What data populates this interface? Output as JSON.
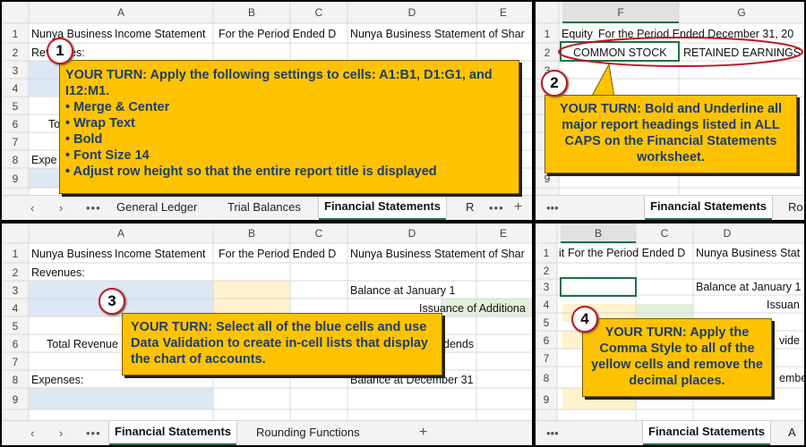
{
  "colors": {
    "accent": "#1e7145",
    "callout": "#fdc300",
    "callout_text": "#1f3d6e",
    "blue_cell": "#dce9f5",
    "yellow_cell": "#fff2cc",
    "green_cell": "#e2efda",
    "badge_ring": "#c0151c"
  },
  "panel1": {
    "columns": [
      "A",
      "B",
      "C",
      "D",
      "E"
    ],
    "rows": [
      "1",
      "2",
      "3",
      "4",
      "5",
      "6",
      "7",
      "8",
      "9"
    ],
    "cells": {
      "a1": "Nunya Business",
      "b1": "Income Statement",
      "c1": "For the Period Ended D",
      "d1": "Nunya Business",
      "e1": "Statement of Shar",
      "a2": "Revenues:",
      "a6": "To",
      "a8": "Expe"
    },
    "tabs": [
      "General Ledger",
      "Trial Balances",
      "Financial Statements",
      "R"
    ],
    "add_tab": "+",
    "badge": "1",
    "callout": {
      "line1": "YOUR TURN: Apply the following settings to cells: A1:B1, D1:G1, and I12:M1.",
      "bullets": [
        "• Merge & Center",
        "• Wrap Text",
        "• Bold",
        "• Font Size 14",
        "• Adjust row height so that the entire report title is displayed"
      ]
    }
  },
  "panel2": {
    "columns": [
      "F",
      "G"
    ],
    "rows": [
      "1",
      "2",
      "3",
      "4",
      "5",
      "6",
      "7",
      "8",
      "9"
    ],
    "cells": {
      "f1": "Equity",
      "f1b": "For the Period Ended December 31, 20",
      "f2": "COMMON STOCK",
      "g2": "RETAINED EARNINGS"
    },
    "tabs": [
      "Financial Statements",
      "Ro"
    ],
    "badge": "2",
    "callout": "YOUR TURN: Bold and Underline all major report headings listed in ALL CAPS on the Financial Statements worksheet."
  },
  "panel3": {
    "columns": [
      "A",
      "B",
      "C",
      "D",
      "E"
    ],
    "rows": [
      "1",
      "2",
      "3",
      "4",
      "5",
      "6",
      "7",
      "8",
      "9"
    ],
    "cells": {
      "a1": "Nunya Business",
      "b1": "Income Statement",
      "c1": "For the Period Ended D",
      "d1": "Nunya Business",
      "e1": "Statement of Shar",
      "a2": "Revenues:",
      "a6": "Total Revenue",
      "a8": "Expenses:",
      "d3": "Balance at January 1",
      "d4": "Issuance of Additiona",
      "d6": "dends",
      "d8": "Balance at December 31"
    },
    "tabs": [
      "Financial Statements",
      "Rounding Functions"
    ],
    "add_tab": "+",
    "badge": "3",
    "callout": "YOUR TURN: Select all of the blue cells and use Data Validation to create in-cell lists that display the chart of accounts."
  },
  "panel4": {
    "columns": [
      "B",
      "C",
      "D"
    ],
    "rows": [
      "1",
      "2",
      "3",
      "4",
      "5",
      "6",
      "7",
      "8",
      "9"
    ],
    "cells": {
      "b1": "it",
      "c1": "For the Period Ended D",
      "d1": "Nunya Business",
      "d1b": "Stat",
      "d3": "Balance at January 1",
      "d4": "Issuan",
      "d6": "vide",
      "d8": "embe"
    },
    "tabs": [
      "Financial Statements",
      "A"
    ],
    "badge": "4",
    "callout": "YOUR TURN: Apply the Comma Style to all of the yellow cells and remove the decimal places."
  }
}
